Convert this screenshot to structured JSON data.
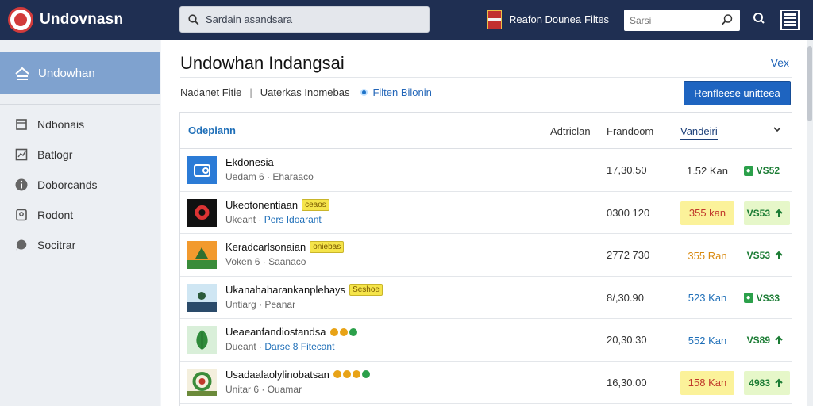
{
  "topbar": {
    "brand": "Undovnasn",
    "search_placeholder": "Sardain asandsara",
    "region": "Reafon Dounea",
    "files": "Filtes",
    "top_search_placeholder": "Sarsi"
  },
  "sidebar": {
    "active": "Undowhan",
    "items": [
      {
        "label": "Ndbonais",
        "icon": "bookmark-icon"
      },
      {
        "label": "Batlogr",
        "icon": "chart-icon"
      },
      {
        "label": "Doborcands",
        "icon": "info-icon"
      },
      {
        "label": "Rodont",
        "icon": "document-icon"
      },
      {
        "label": "Socitrar",
        "icon": "chat-icon"
      }
    ]
  },
  "main": {
    "title": "Undowhan Indangsai",
    "view_link": "Vex",
    "filter_one": "Nadanet Fitie",
    "filter_two": "Uaterkas Inomebas",
    "filter_link": "Filten Bilonin",
    "primary_button": "Renfleese unitteea"
  },
  "table": {
    "headers": {
      "name": "Odepiann",
      "a": "Adtriclan",
      "b": "Frandoom",
      "c": "Vandeiri"
    },
    "rows": [
      {
        "title": "Ekdonesia",
        "badge": "",
        "stars": [],
        "sub_a": "Uedam 6",
        "sub_b": "Eharaaco",
        "sub_b_highlight": false,
        "num": "17,30.50",
        "dist": "1.52 Kan",
        "code": "VS52",
        "thumb": "folder",
        "dist_highlight": false,
        "dist_color": "#333",
        "code_pill": true
      },
      {
        "title": "Ukeotonentiaan",
        "badge": "ceaos",
        "stars": [],
        "sub_a": "Ukeant",
        "sub_b": "Pers Idoarant",
        "sub_b_highlight": true,
        "num": "0300 120",
        "dist": "355 kan",
        "code": "VS53",
        "thumb": "dark",
        "dist_highlight": true,
        "dist_color": "#c0392b",
        "code_pill": false
      },
      {
        "title": "Keradcarlsonaian",
        "badge": "oniebas",
        "stars": [],
        "sub_a": "Voken 6",
        "sub_b": "Saanaco",
        "sub_b_highlight": false,
        "num": "2772 730",
        "dist": "355 Ran",
        "code": "VS53",
        "thumb": "orange",
        "dist_highlight": false,
        "dist_color": "#d98b13",
        "code_pill": false
      },
      {
        "title": "Ukanahaharankanplehays",
        "badge": "Seshoe",
        "stars": [],
        "sub_a": "Untiarg",
        "sub_b": "Peanar",
        "sub_b_highlight": false,
        "num": "8/,30.90",
        "dist": "523 Kan",
        "code": "VS33",
        "thumb": "photo",
        "dist_highlight": false,
        "dist_color": "#1f6fb8",
        "code_pill": true
      },
      {
        "title": "Ueaeanfandiostandsa",
        "badge": "",
        "stars": [
          "#e8a317",
          "#e8a317",
          "#2ba04a"
        ],
        "sub_a": "Dueant",
        "sub_b": "Darse 8 Fitecant",
        "sub_b_highlight": true,
        "num": "20,30.30",
        "dist": "552 Kan",
        "code": "VS89",
        "thumb": "leaf",
        "dist_highlight": false,
        "dist_color": "#1f6fb8",
        "code_pill": false
      },
      {
        "title": "Usadaalaolylinobatsan",
        "badge": "",
        "stars": [
          "#e8a317",
          "#e8a317",
          "#e8a317",
          "#2ba04a"
        ],
        "sub_a": "Unitar 6",
        "sub_b": "Ouamar",
        "sub_b_highlight": false,
        "num": "16,30.00",
        "dist": "158 Kan",
        "code": "4983",
        "thumb": "wreath",
        "dist_highlight": true,
        "dist_color": "#c0392b",
        "code_pill": false
      }
    ]
  }
}
